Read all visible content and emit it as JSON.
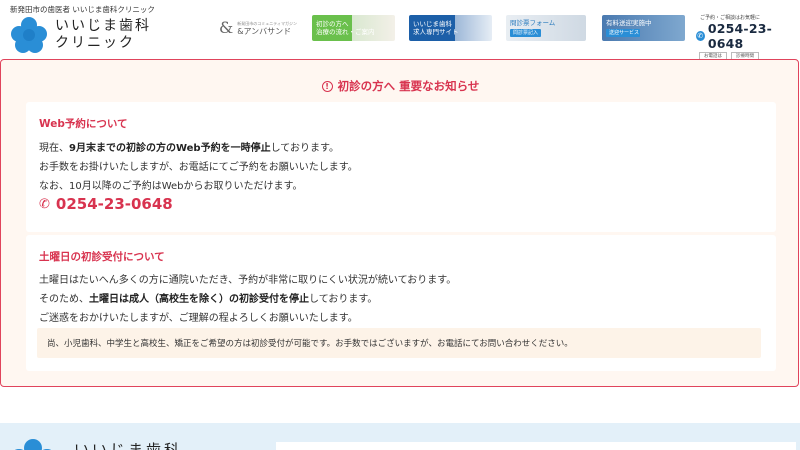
{
  "header": {
    "tagline": "新発田市の歯医者 いいじま歯科クリニック",
    "logo_line1": "いいじま歯科",
    "logo_line2": "クリニック",
    "banners": {
      "andfamily_small": "新発田市のコミュニティマガジン",
      "andfamily_main": "&アンバサンド",
      "first_visit_line1": "初診の方へ",
      "first_visit_line2": "治療の流れ・ご案内",
      "recruit_line1": "いいじま歯科",
      "recruit_line2": "求人専門サイト",
      "form_line1": "問診票フォーム",
      "form_btn": "問診票記入",
      "tour_line1": "有料送迎実施中",
      "tour_btn": "送迎サービス"
    },
    "tel": {
      "caption": "ご予約・ご相談はお気軽に",
      "number": "0254-23-0648",
      "link1": "お電話は",
      "link2": "診療時間"
    }
  },
  "notice": {
    "title": "初診の方へ 重要なお知らせ",
    "web": {
      "heading": "Web予約について",
      "line1_pre": "現在、",
      "line1_bold": "9月末までの初診の方のWeb予約を一時停止",
      "line1_post": "しております。",
      "line2": "お手数をお掛けいたしますが、お電話にてご予約をお願いいたします。",
      "line3": "なお、10月以降のご予約はWebからお取りいただけます。",
      "phone": "0254-23-0648"
    },
    "weekend": {
      "heading": "土曜日の初診受付について",
      "line1": "土曜日はたいへん多くの方に通院いただき、予約が非常に取りにくい状況が続いております。",
      "line2_pre": "そのため、",
      "line2_bold": "土曜日は成人（高校生を除く）の初診受付を停止",
      "line2_post": "しております。",
      "line3": "ご迷惑をおかけいたしますが、ご理解の程よろしくお願いいたします。",
      "note": "尚、小児歯科、中学生と高校生、矯正をご希望の方は初診受付が可能です。お手数ではございますが、お電話にてお問い合わせください。"
    }
  },
  "footer": {
    "name": "いいじま歯科"
  },
  "colors": {
    "accent": "#d8334f",
    "brand_blue": "#2a8ed6",
    "panel_bg": "#fff7f1"
  }
}
